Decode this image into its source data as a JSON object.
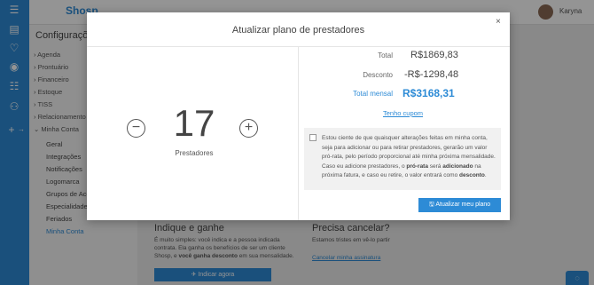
{
  "app": {
    "logo_text": "Shosp",
    "user_name": "Karyna"
  },
  "settings": {
    "title": "Configurações",
    "items": [
      "Agenda",
      "Prontuário",
      "Financeiro",
      "Estoque",
      "TISS",
      "Relacionamento c",
      "Minha Conta"
    ],
    "subitems": [
      "Geral",
      "Integrações",
      "Notificações",
      "Logomarca",
      "Grupos de Ace",
      "Especialidades",
      "Feriados",
      "Minha Conta"
    ]
  },
  "background": {
    "refer": {
      "title": "Indique e ganhe",
      "text1": "É muito simples: você indica e a pessoa indicada",
      "text2": "contrata. Ela ganha os benefícios de ser um cliente",
      "text3_a": "Shosp, e ",
      "text3_b": "você ganha desconto",
      "text3_c": " em sua mensalidade.",
      "button": "Indicar agora"
    },
    "cancel": {
      "title": "Precisa cancelar?",
      "text": "Estamos tristes em vê-lo partir",
      "link": "Cancelar minha assinatura"
    }
  },
  "modal": {
    "title": "Atualizar plano de prestadores",
    "close": "×",
    "count": "17",
    "count_label": "Prestadores",
    "minus": "−",
    "plus": "+",
    "total_label": "Total",
    "total_value": "R$1869,83",
    "discount_label": "Desconto",
    "discount_value": "-R$-1298,48",
    "monthly_label": "Total mensal",
    "monthly_value": "R$3168,31",
    "coupon_link": "Tenho cupom",
    "notice": {
      "p1": "Estou ciente de que quaisquer alterações feitas em minha conta, seja para adicionar ou para retirar prestadores, gerarão um valor pró-rata, pelo período proporcional até minha próxima mensalidade. Caso eu adicione prestadores, o ",
      "b1": "pró-rata",
      "p2": " será ",
      "b2": "adicionado",
      "p3": " na próxima fatura, e caso eu retire, o valor entrará como ",
      "b3": "desconto",
      "p4": "."
    },
    "update_button": "Atualizar meu plano"
  },
  "colors": {
    "accent": "#2d8bd6"
  },
  "icons": [
    "menu-icon",
    "calendar-icon",
    "heart-icon",
    "money-icon",
    "list-icon",
    "users-icon",
    "plus-icon",
    "arrow-icon",
    "search-icon",
    "bell-icon",
    "chat-icon"
  ]
}
